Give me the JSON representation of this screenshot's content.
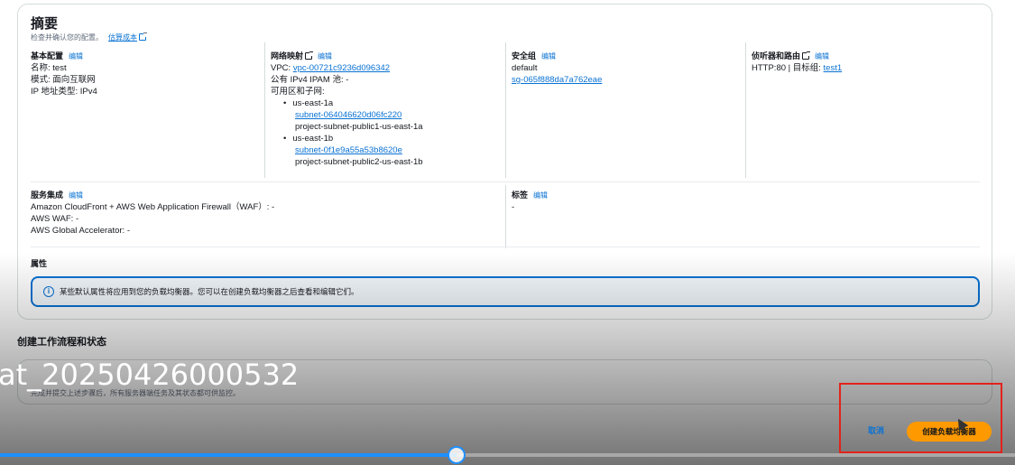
{
  "summary": {
    "title": "摘要",
    "subtitle": "检查并确认您的配置。",
    "estimate_link": "估算成本",
    "edit_label": "编辑"
  },
  "basic": {
    "heading": "基本配置",
    "lines": [
      "名称: test",
      "模式: 面向互联网",
      "IP 地址类型: IPv4"
    ]
  },
  "network": {
    "heading": "网络映射",
    "vpc_label": "VPC: ",
    "vpc_value": "vpc-00721c9236d096342",
    "ipam": "公有 IPv4 IPAM 池: -",
    "az_label": "可用区和子网:",
    "subnets": [
      {
        "az": "us-east-1a",
        "id": "subnet-064046620d06fc220",
        "name": "project-subnet-public1-us-east-1a"
      },
      {
        "az": "us-east-1b",
        "id": "subnet-0f1e9a55a53b8620e",
        "name": "project-subnet-public2-us-east-1b"
      }
    ]
  },
  "security": {
    "heading": "安全组",
    "default": "default",
    "sg_id": "sg-065f888da7a762eae"
  },
  "listeners": {
    "heading": "侦听器和路由",
    "text": "HTTP:80 | 目标组: ",
    "target": "test1"
  },
  "services": {
    "heading": "服务集成",
    "lines": [
      "Amazon CloudFront + AWS Web Application Firewall（WAF）: -",
      "AWS WAF: -",
      "AWS Global Accelerator: -"
    ]
  },
  "tags": {
    "heading": "标签",
    "value": "-"
  },
  "attributes": {
    "heading": "属性",
    "info": "某些默认属性将应用到您的负载均衡器。您可以在创建负载均衡器之后查看和编辑它们。"
  },
  "workflow": {
    "title": "创建工作流程和状态",
    "desc": "完成并提交上述步骤后，所有服务器端任务及其状态都可供监控。"
  },
  "actions": {
    "cancel": "取消",
    "create": "创建负载均衡器"
  },
  "video": {
    "watermark": "at_20250426000532",
    "progress": 0.45,
    "accent": "#1e90ff"
  }
}
